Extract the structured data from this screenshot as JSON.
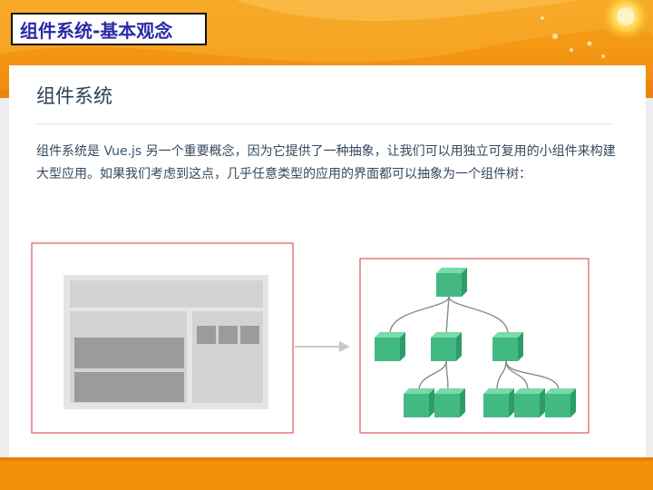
{
  "slide": {
    "title": "组件系统-基本观念",
    "colors": {
      "orange": "#f39a12",
      "dark_orange": "#e8780a",
      "title_text": "#2b2ba8",
      "component_green": "#42b983",
      "outline_red": "#d9363e"
    }
  },
  "content": {
    "heading": "组件系统",
    "paragraph_pre": "组件系统是 ",
    "paragraph_code": "Vue.js",
    "paragraph_post": " 另一个重要概念，因为它提供了一种抽象，让我们可以用独立可复用的小组件来构建大型应用。如果我们考虑到这点，几乎任意类型的应用的界面都可以抽象为一个组件树："
  },
  "diagram": {
    "left": "page-layout-wireframe",
    "arrow": "arrow-right-icon",
    "right": "component-tree"
  }
}
